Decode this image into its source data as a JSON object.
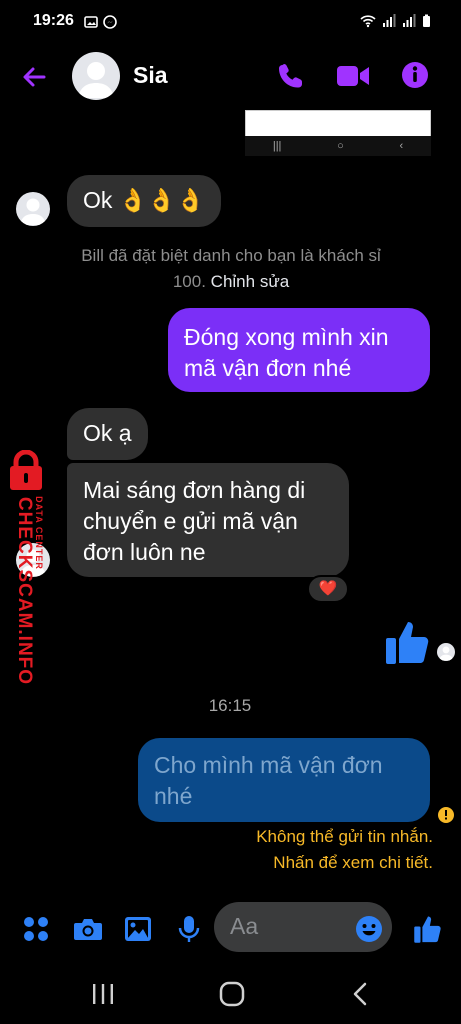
{
  "status": {
    "time": "19:26"
  },
  "header": {
    "name": "Sia"
  },
  "messages": {
    "m1": "Ok 👌👌👌",
    "system": "Bill đã đặt biệt danh cho bạn là khách sỉ 100.",
    "system_link": "Chỉnh sửa",
    "m2": "Đóng xong mình xin mã vận đơn nhé",
    "m3": "Ok ạ",
    "m4": "Mai sáng đơn hàng di chuyển e gửi mã vận đơn luôn ne",
    "reaction": "❤️",
    "time": "16:15",
    "m5": "Cho mình mã vận đơn nhé",
    "error_line1": "Không thể gửi tin nhắn.",
    "error_line2": "Nhấn để xem chi tiết."
  },
  "watermark": {
    "brand": "CHECKSCAM.INFO",
    "sub": "DATA CENTER"
  },
  "composer": {
    "placeholder": "Aa"
  },
  "colors": {
    "accent": "#8a2be2",
    "outgoing": "#7b2ff7",
    "blue": "#2e81f7",
    "error": "#f7b928"
  }
}
